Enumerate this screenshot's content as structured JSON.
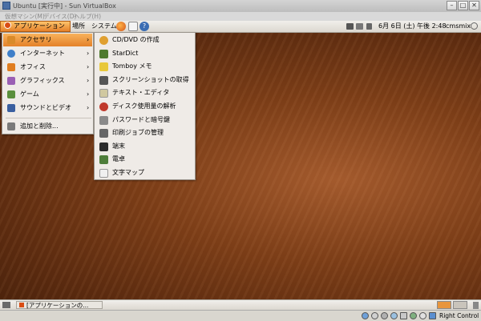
{
  "host": {
    "window_title": "Ubuntu [実行中] - Sun VirtualBox",
    "menu": [
      "仮想マシン(M)",
      "デバイス(D)",
      "ヘルプ(H)"
    ],
    "status_right": "Right Control"
  },
  "panel": {
    "apps_label": "アプリケーション",
    "places_label": "場所",
    "system_label": "システム",
    "clock": "6月 6日 (土) 午後 2:48",
    "user": "cmsmix"
  },
  "app_menu": {
    "items": [
      {
        "label": "アクセサリ",
        "icon": "accessories-icon",
        "color": "#d98a2a",
        "submenu": true,
        "selected": true
      },
      {
        "label": "インターネット",
        "icon": "internet-icon",
        "color": "#3f7fc8",
        "submenu": true
      },
      {
        "label": "オフィス",
        "icon": "office-icon",
        "color": "#e07d1f",
        "submenu": true
      },
      {
        "label": "グラフィックス",
        "icon": "graphics-icon",
        "color": "#9a5fb4",
        "submenu": true
      },
      {
        "label": "ゲーム",
        "icon": "games-icon",
        "color": "#5a8f3c",
        "submenu": true
      },
      {
        "label": "サウンドとビデオ",
        "icon": "sound-video-icon",
        "color": "#3a5fa0",
        "submenu": true
      },
      {
        "label": "追加と削除...",
        "icon": "add-remove-icon",
        "color": "#7a7a7a",
        "submenu": false
      }
    ]
  },
  "accessories_menu": {
    "items": [
      {
        "label": "CD/DVD の作成",
        "icon": "cd-dvd-icon",
        "color": "#e0a030"
      },
      {
        "label": "StarDict",
        "icon": "stardict-icon",
        "color": "#4f7a2e"
      },
      {
        "label": "Tomboy メモ",
        "icon": "tomboy-icon",
        "color": "#e8c83a"
      },
      {
        "label": "スクリーンショットの取得",
        "icon": "camera-icon",
        "color": "#555555"
      },
      {
        "label": "テキスト・エディタ",
        "icon": "text-editor-icon",
        "color": "#d0c8a0"
      },
      {
        "label": "ディスク使用量の解析",
        "icon": "disk-usage-icon",
        "color": "#c0392b"
      },
      {
        "label": "パスワードと暗号鍵",
        "icon": "keys-icon",
        "color": "#8a8a8a"
      },
      {
        "label": "印刷ジョブの管理",
        "icon": "printer-icon",
        "color": "#666666"
      },
      {
        "label": "端末",
        "icon": "terminal-icon",
        "color": "#2b2b2b"
      },
      {
        "label": "電卓",
        "icon": "calculator-icon",
        "color": "#4e7d3a"
      },
      {
        "label": "文字マップ",
        "icon": "charmap-icon",
        "color": "#f0f0f0"
      }
    ]
  },
  "taskbar": {
    "task_label": "[アプリケーションの..."
  },
  "workspaces": [
    "#e8953c",
    "#c9c4bb"
  ]
}
